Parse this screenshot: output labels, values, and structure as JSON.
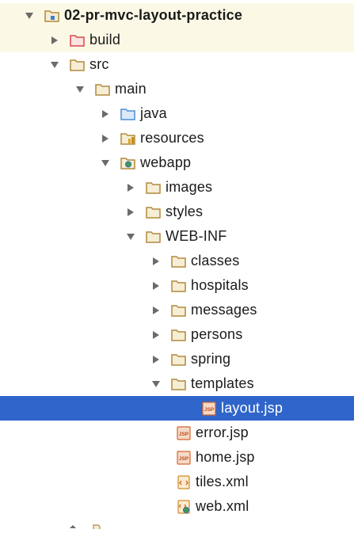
{
  "tree": {
    "rows": [
      {
        "label": "02-pr-mvc-layout-practice",
        "icon": "module-folder-icon",
        "arrow": "expanded"
      },
      {
        "label": "build",
        "icon": "excluded-folder-icon",
        "arrow": "collapsed"
      },
      {
        "label": "src",
        "icon": "folder-icon",
        "arrow": "expanded"
      },
      {
        "label": "main",
        "icon": "folder-icon",
        "arrow": "expanded"
      },
      {
        "label": "java",
        "icon": "source-folder-icon",
        "arrow": "collapsed"
      },
      {
        "label": "resources",
        "icon": "resources-folder-icon",
        "arrow": "collapsed"
      },
      {
        "label": "webapp",
        "icon": "web-folder-icon",
        "arrow": "expanded"
      },
      {
        "label": "images",
        "icon": "folder-icon",
        "arrow": "collapsed"
      },
      {
        "label": "styles",
        "icon": "folder-icon",
        "arrow": "collapsed"
      },
      {
        "label": "WEB-INF",
        "icon": "folder-icon",
        "arrow": "expanded"
      },
      {
        "label": "classes",
        "icon": "folder-icon",
        "arrow": "collapsed"
      },
      {
        "label": "hospitals",
        "icon": "folder-icon",
        "arrow": "collapsed"
      },
      {
        "label": "messages",
        "icon": "folder-icon",
        "arrow": "collapsed"
      },
      {
        "label": "persons",
        "icon": "folder-icon",
        "arrow": "collapsed"
      },
      {
        "label": "spring",
        "icon": "folder-icon",
        "arrow": "collapsed"
      },
      {
        "label": "templates",
        "icon": "folder-icon",
        "arrow": "expanded"
      },
      {
        "label": "layout.jsp",
        "icon": "jsp-file-icon",
        "arrow": "none",
        "selected": true
      },
      {
        "label": "error.jsp",
        "icon": "jsp-file-icon",
        "arrow": "none"
      },
      {
        "label": "home.jsp",
        "icon": "jsp-file-icon",
        "arrow": "none"
      },
      {
        "label": "tiles.xml",
        "icon": "xml-file-icon",
        "arrow": "none"
      },
      {
        "label": "web.xml",
        "icon": "web-xml-file-icon",
        "arrow": "none"
      }
    ]
  },
  "colors": {
    "selection": "#2f65ca",
    "highlight_row": "#fbf9e6",
    "folder": "#b08a3c",
    "excluded_folder": "#d9474b",
    "source_folder": "#4a8fd6",
    "jsp": "#d5632c"
  }
}
